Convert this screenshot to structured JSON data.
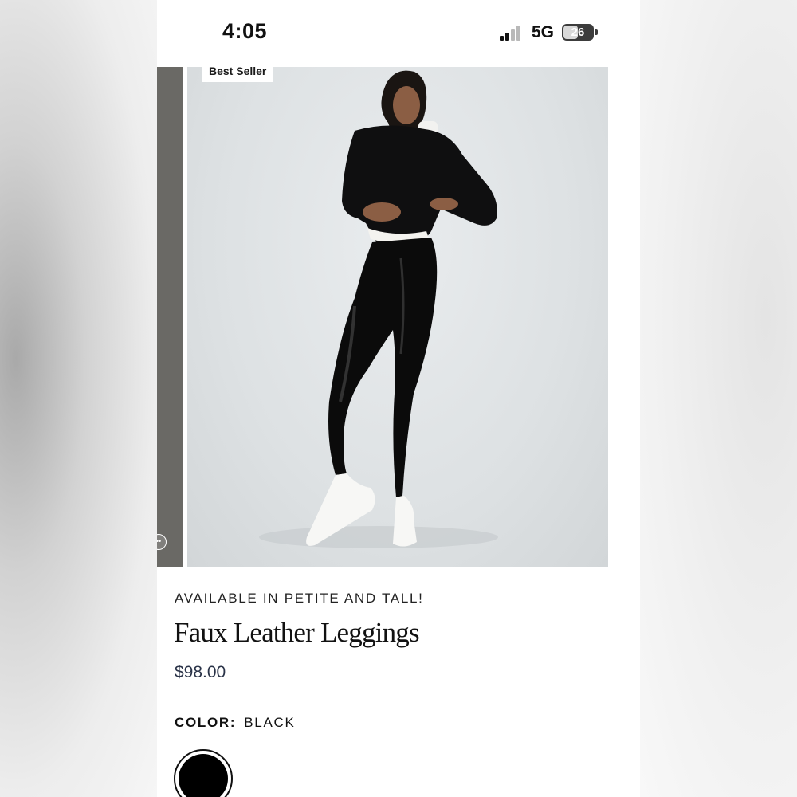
{
  "status_bar": {
    "time": "4:05",
    "network": "5G",
    "battery": "26",
    "signal_bars_active": 2,
    "signal_bars_total": 4
  },
  "product": {
    "badge": "Best Seller",
    "promo": "AVAILABLE IN PETITE AND TALL!",
    "title": "Faux Leather Leggings",
    "price": "$98.00",
    "color_label": "COLOR:",
    "color_value": "BLACK",
    "swatches": [
      {
        "name": "black",
        "color": "#000000",
        "selected": true
      }
    ]
  },
  "colors": {
    "text": "#111111",
    "price": "#2a3348",
    "hero_bg": "#dde1e3",
    "prev_slide": "#6a6965"
  },
  "icons": [
    "signal-icon",
    "battery-icon",
    "more-icon"
  ]
}
